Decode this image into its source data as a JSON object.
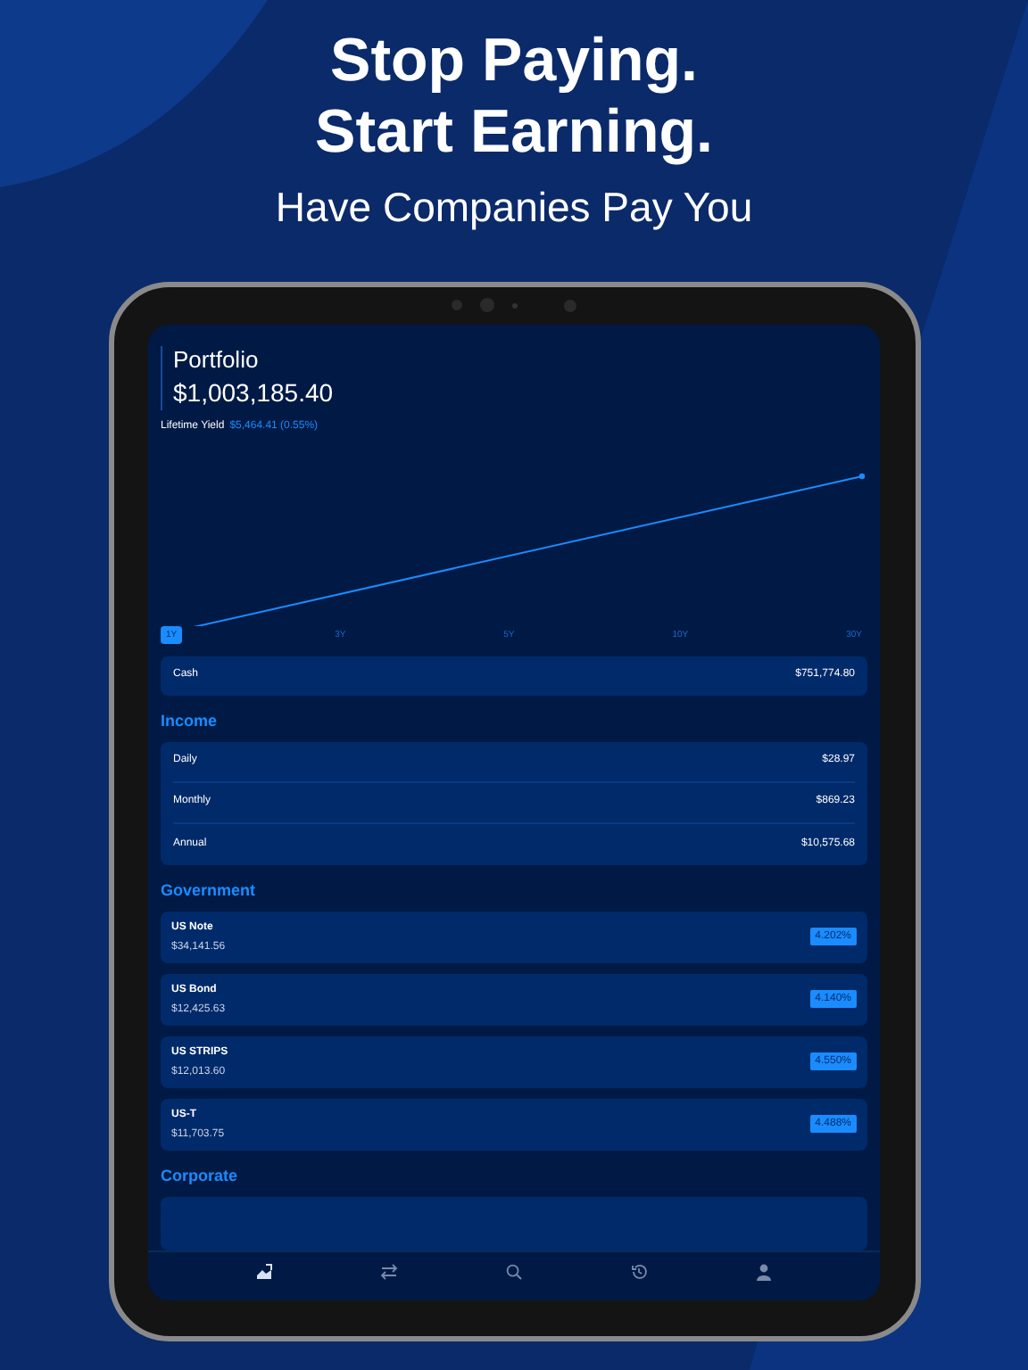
{
  "headline": [
    "Stop Paying.",
    "Start Earning."
  ],
  "subheadline": "Have Companies Pay You",
  "portfolio": {
    "title": "Portfolio",
    "value": "$1,003,185.40",
    "yield_label": "Lifetime Yield",
    "yield_value": "$5,464.41 (0.55%)"
  },
  "periods": [
    {
      "label": "1Y",
      "selected": true
    },
    {
      "label": "3Y",
      "selected": false
    },
    {
      "label": "5Y",
      "selected": false
    },
    {
      "label": "10Y",
      "selected": false
    },
    {
      "label": "30Y",
      "selected": false
    }
  ],
  "cash": {
    "label": "Cash",
    "value": "$751,774.80"
  },
  "income": {
    "title": "Income",
    "rows": [
      {
        "label": "Daily",
        "value": "$28.97"
      },
      {
        "label": "Monthly",
        "value": "$869.23"
      },
      {
        "label": "Annual",
        "value": "$10,575.68"
      }
    ]
  },
  "government": {
    "title": "Government",
    "items": [
      {
        "name": "US Note",
        "amount": "$34,141.56",
        "rate": "4.202%"
      },
      {
        "name": "US Bond",
        "amount": "$12,425.63",
        "rate": "4.140%"
      },
      {
        "name": "US STRIPS",
        "amount": "$12,013.60",
        "rate": "4.550%"
      },
      {
        "name": "US-T",
        "amount": "$11,703.75",
        "rate": "4.488%"
      }
    ]
  },
  "corporate": {
    "title": "Corporate"
  },
  "tab_bar": [
    {
      "kind": "chart",
      "selected": true
    },
    {
      "kind": "transfer",
      "selected": false
    },
    {
      "kind": "search",
      "selected": false
    },
    {
      "kind": "history",
      "selected": false
    },
    {
      "kind": "profile",
      "selected": false
    }
  ]
}
